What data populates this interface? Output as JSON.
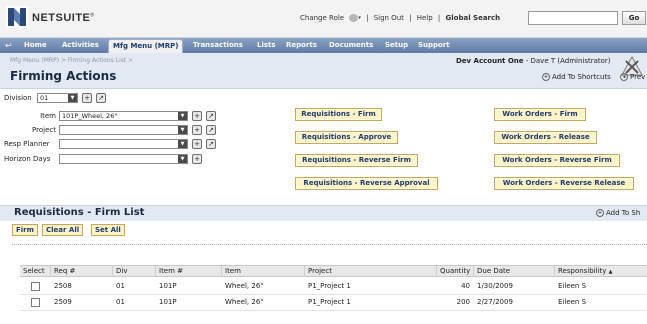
{
  "brand": {
    "name": "NETSUITE",
    "mark": "®"
  },
  "topbar": {
    "change_role": "Change Role",
    "sign_out": "Sign Out",
    "help": "Help",
    "global_search": "Global Search",
    "search_value": "",
    "go_label": "Go",
    "separator": "|"
  },
  "nav": {
    "items": [
      "Home",
      "Activities",
      "Mfg Menu (MRP)",
      "Transactions",
      "Lists",
      "Reports",
      "Documents",
      "Setup",
      "Support"
    ],
    "active": "Mfg Menu (MRP)"
  },
  "header": {
    "breadcrumb": "Mfg Menu (MRP) > Firming Actions List >",
    "title": "Firming Actions",
    "account": "Dev Account One",
    "user": "- Dave T (Administrator)",
    "add_shortcut": "Add To Shortcuts",
    "prev": "Prev"
  },
  "form": {
    "division_label": "Division",
    "division_value": "01",
    "item_label": "Item",
    "item_value": "101P_Wheel, 26\"",
    "project_label": "Project",
    "project_value": "",
    "resp_label": "Resp Planner",
    "resp_value": "",
    "horizon_label": "Horizon Days",
    "horizon_value": ""
  },
  "actions": {
    "req_firm": "Requisitions - Firm",
    "req_approve": "Requisitions - Approve",
    "req_rev_firm": "Requisitions - Reverse Firm",
    "req_rev_approval": "Requisitions - Reverse Approval",
    "wo_firm": "Work Orders - Firm",
    "wo_release": "Work Orders - Release",
    "wo_rev_firm": "Work Orders - Reverse Firm",
    "wo_rev_release": "Work Orders - Reverse Release"
  },
  "list": {
    "title": "Requisitions - Firm List",
    "add_shortcut": "Add To Sh",
    "firm_btn": "Firm",
    "clear_all_btn": "Clear All",
    "set_all_btn": "Set All",
    "columns": [
      "Select",
      "Req #",
      "Div",
      "Item #",
      "Item",
      "Project",
      "Quantity",
      "Due Date",
      "Responsibility"
    ],
    "sort_indicator": "▲",
    "rows": [
      {
        "req": "2508",
        "div": "01",
        "item_no": "101P",
        "item": "Wheel, 26\"",
        "project": "P1_Project 1",
        "qty": "40",
        "due": "1/30/2009",
        "resp": "Eileen S"
      },
      {
        "req": "2509",
        "div": "01",
        "item_no": "101P",
        "item": "Wheel, 26\"",
        "project": "P1_Project 1",
        "qty": "200",
        "due": "2/27/2009",
        "resp": "Eileen S"
      }
    ]
  },
  "icons": {
    "logo": "netsuite-logo",
    "role": "globe-icon",
    "back": "back-arrow-icon",
    "add": "plus-circle-icon",
    "open": "open-record-icon",
    "account": "settings-tools-icon"
  },
  "colors": {
    "nav_bg": "#6f8ab3",
    "header_bg": "#e3e9f2",
    "button_bg": "#fff4c8",
    "button_border": "#c8a75a",
    "title_text": "#1a2a44"
  }
}
